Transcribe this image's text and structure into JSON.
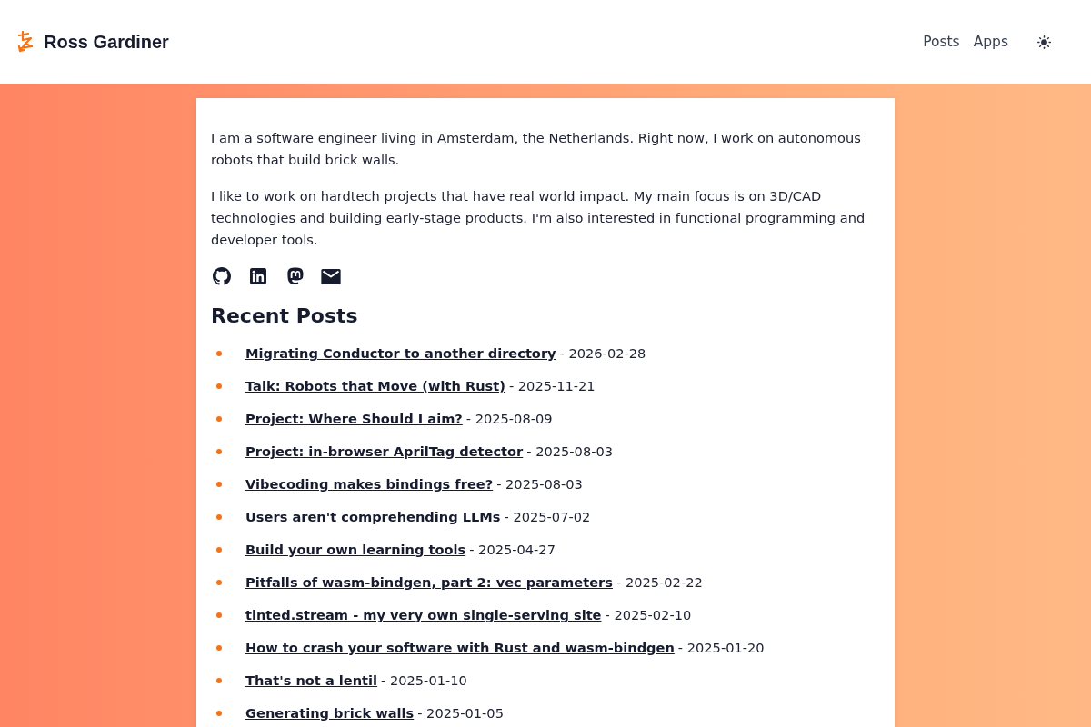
{
  "header": {
    "site_title": "Ross Gardiner",
    "nav": [
      {
        "label": "Posts"
      },
      {
        "label": "Apps"
      }
    ]
  },
  "intro": {
    "paragraphs": [
      "I am a software engineer living in Amsterdam, the Netherlands. Right now, I work on autonomous robots that build brick walls.",
      "I like to work on hardtech projects that have real world impact. My main focus is on 3D/CAD technologies and building early-stage products. I'm also interested in functional programming and developer tools."
    ],
    "social_links": [
      {
        "kind": "github"
      },
      {
        "kind": "linkedin"
      },
      {
        "kind": "mastodon"
      },
      {
        "kind": "email"
      }
    ]
  },
  "recent_posts": {
    "heading": "Recent Posts",
    "separator": "-",
    "posts": [
      {
        "title": "Migrating Conductor to another directory",
        "date": "2026-02-28"
      },
      {
        "title": "Talk: Robots that Move (with Rust)",
        "date": "2025-11-21"
      },
      {
        "title": "Project: Where Should I aim?",
        "date": "2025-08-09"
      },
      {
        "title": "Project: in-browser AprilTag detector",
        "date": "2025-08-03"
      },
      {
        "title": "Vibecoding makes bindings free?",
        "date": "2025-08-03"
      },
      {
        "title": "Users aren't comprehending LLMs",
        "date": "2025-07-02"
      },
      {
        "title": "Build your own learning tools",
        "date": "2025-04-27"
      },
      {
        "title": "Pitfalls of wasm-bindgen, part 2: vec parameters",
        "date": "2025-02-22"
      },
      {
        "title": "tinted.stream - my very own single-serving site",
        "date": "2025-02-10"
      },
      {
        "title": "How to crash your software with Rust and wasm-bindgen",
        "date": "2025-01-20"
      },
      {
        "title": "That's not a lentil",
        "date": "2025-01-10"
      },
      {
        "title": "Generating brick walls",
        "date": "2025-01-05"
      }
    ]
  }
}
